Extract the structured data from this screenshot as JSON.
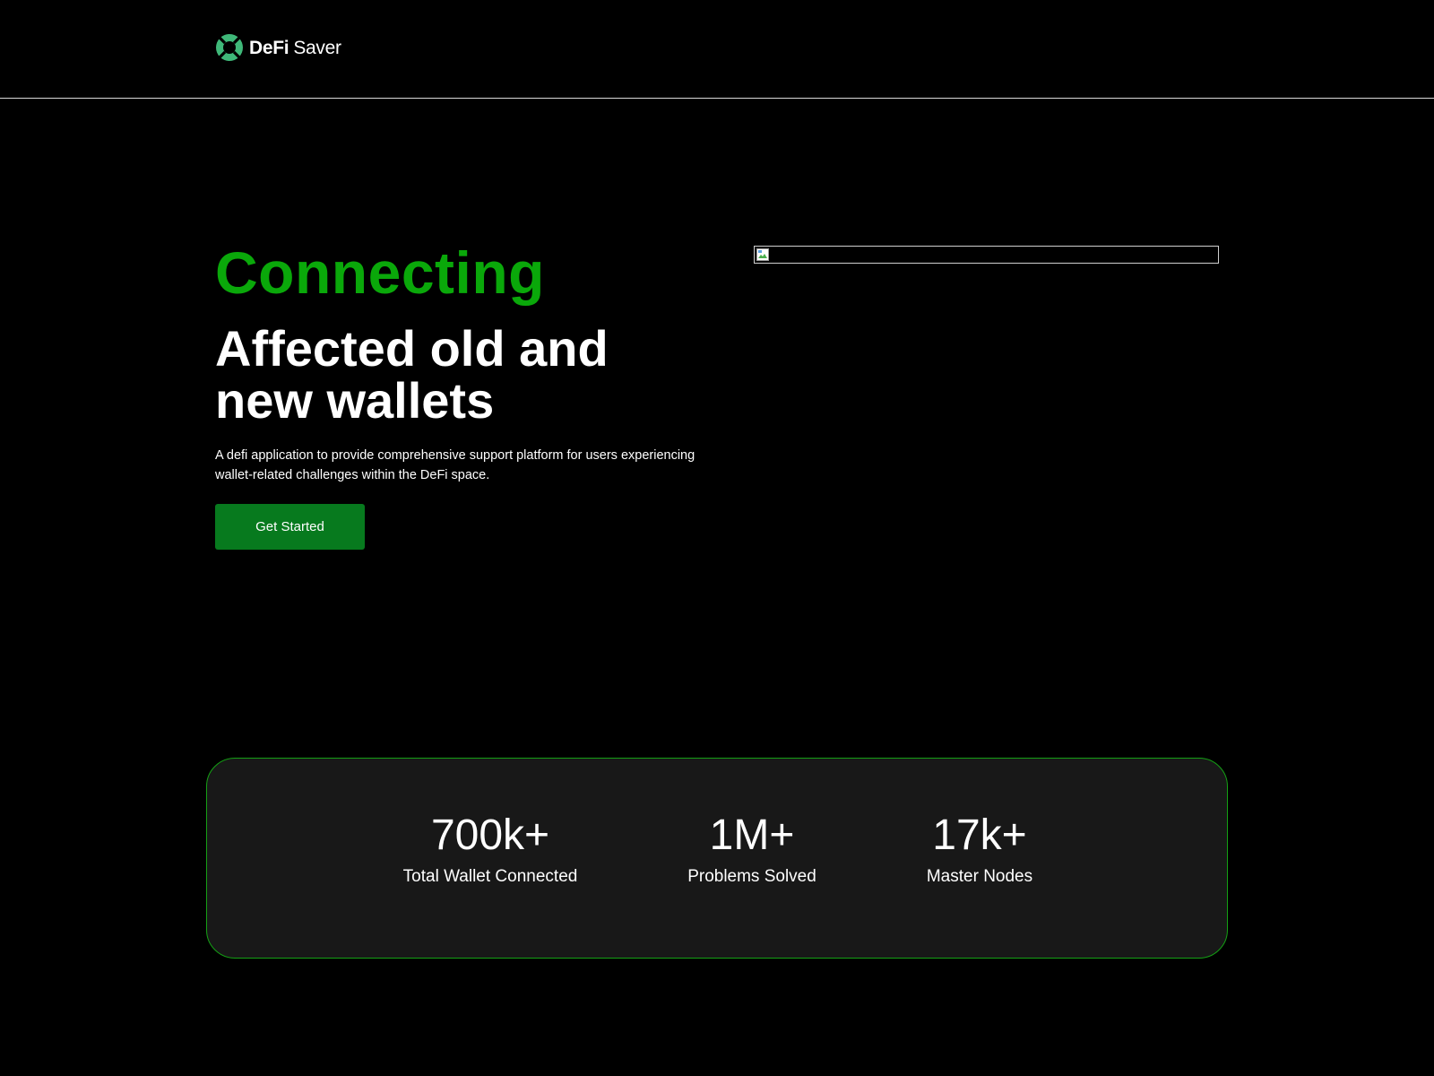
{
  "colors": {
    "accent_green": "#0aa80a",
    "button_green": "#077a1e",
    "card_background": "#181818",
    "card_border": "#14a014",
    "logo_green": "#3fb879"
  },
  "header": {
    "logo_icon": "lifebuoy-icon",
    "logo_bold": "DeFi",
    "logo_light": "Saver"
  },
  "hero": {
    "accent": "Connecting",
    "title": "Affected old and new wallets",
    "description": "A defi application to provide comprehensive support platform for users experiencing wallet-related challenges within the DeFi space.",
    "cta_label": "Get Started",
    "image_icon": "broken-image-icon"
  },
  "stats": [
    {
      "value": "700k+",
      "label": "Total Wallet Connected"
    },
    {
      "value": "1M+",
      "label": "Problems Solved"
    },
    {
      "value": "17k+",
      "label": "Master Nodes"
    }
  ]
}
